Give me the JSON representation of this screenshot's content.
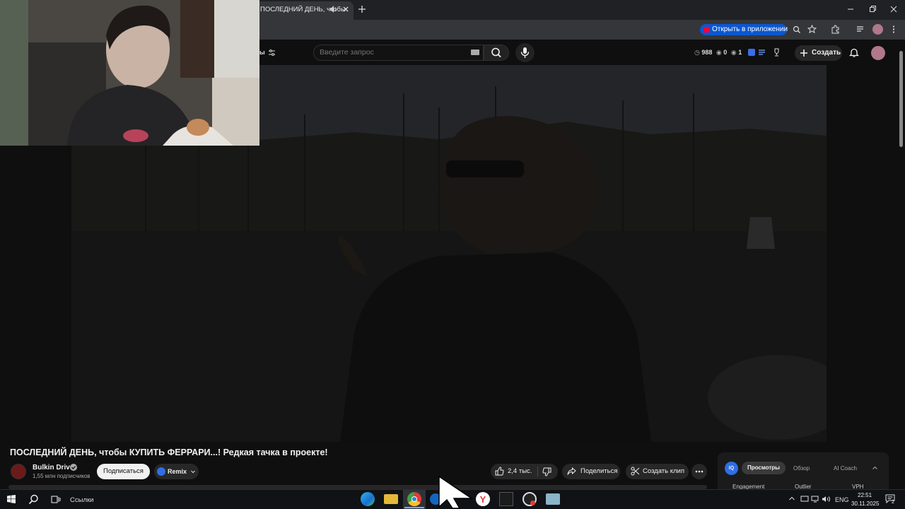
{
  "browser": {
    "tab_title": "ПОСЛЕДНИЙ ДЕНЬ, чтобы",
    "open_in_app_label": "Открыть в приложении"
  },
  "header": {
    "filters_label": "ы",
    "search_placeholder": "Введите запрос",
    "stats": {
      "views": "988",
      "eye1": "0",
      "eye2": "1"
    },
    "create_label": "Создать"
  },
  "video": {
    "title": "ПОСЛЕДНИЙ ДЕНЬ, чтобы КУПИТЬ ФЕРРАРИ...! Редкая тачка в проекте!",
    "channel_name": "Bulkin Drive",
    "channel_avatar_text": "Bulkin Drive",
    "subscribers": "1,55 млн подписчиков",
    "subscribe_label": "Подписаться",
    "remix_label": "Remix",
    "likes": "2,4 тыс.",
    "share_label": "Поделиться",
    "clip_label": "Создать клип"
  },
  "side_panel": {
    "logo_text": "IQ",
    "tabs": [
      "Просмотры",
      "Обзор",
      "AI Coach"
    ],
    "columns": [
      "Engagement",
      "Outlier",
      "VPH"
    ]
  },
  "taskbar": {
    "links_label": "Ссылки",
    "language": "ENG",
    "time": "22:51",
    "date": "30.11.2025",
    "notification_count": "2"
  },
  "colors": {
    "accent": "#0b57d0",
    "youtube_red": "#ff0033",
    "background": "#0f0f0f"
  }
}
